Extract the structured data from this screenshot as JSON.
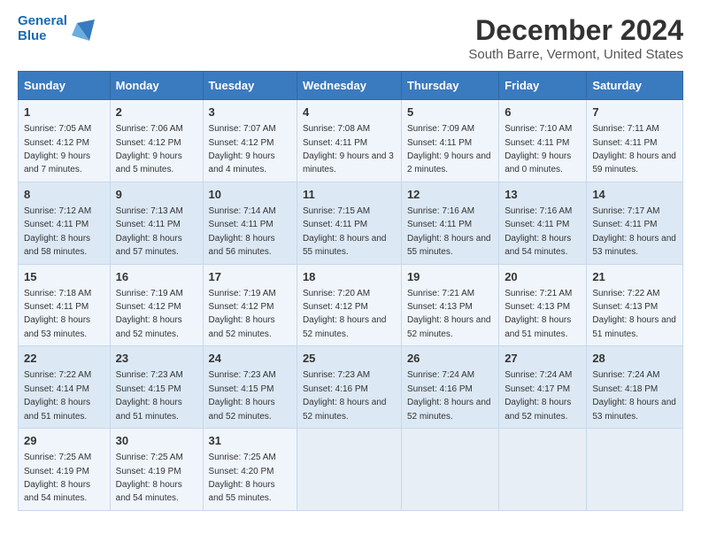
{
  "header": {
    "logo_line1": "General",
    "logo_line2": "Blue",
    "title": "December 2024",
    "subtitle": "South Barre, Vermont, United States"
  },
  "days_of_week": [
    "Sunday",
    "Monday",
    "Tuesday",
    "Wednesday",
    "Thursday",
    "Friday",
    "Saturday"
  ],
  "weeks": [
    [
      {
        "day": "1",
        "sunrise": "7:05 AM",
        "sunset": "4:12 PM",
        "daylight": "9 hours and 7 minutes."
      },
      {
        "day": "2",
        "sunrise": "7:06 AM",
        "sunset": "4:12 PM",
        "daylight": "9 hours and 5 minutes."
      },
      {
        "day": "3",
        "sunrise": "7:07 AM",
        "sunset": "4:12 PM",
        "daylight": "9 hours and 4 minutes."
      },
      {
        "day": "4",
        "sunrise": "7:08 AM",
        "sunset": "4:11 PM",
        "daylight": "9 hours and 3 minutes."
      },
      {
        "day": "5",
        "sunrise": "7:09 AM",
        "sunset": "4:11 PM",
        "daylight": "9 hours and 2 minutes."
      },
      {
        "day": "6",
        "sunrise": "7:10 AM",
        "sunset": "4:11 PM",
        "daylight": "9 hours and 0 minutes."
      },
      {
        "day": "7",
        "sunrise": "7:11 AM",
        "sunset": "4:11 PM",
        "daylight": "8 hours and 59 minutes."
      }
    ],
    [
      {
        "day": "8",
        "sunrise": "7:12 AM",
        "sunset": "4:11 PM",
        "daylight": "8 hours and 58 minutes."
      },
      {
        "day": "9",
        "sunrise": "7:13 AM",
        "sunset": "4:11 PM",
        "daylight": "8 hours and 57 minutes."
      },
      {
        "day": "10",
        "sunrise": "7:14 AM",
        "sunset": "4:11 PM",
        "daylight": "8 hours and 56 minutes."
      },
      {
        "day": "11",
        "sunrise": "7:15 AM",
        "sunset": "4:11 PM",
        "daylight": "8 hours and 55 minutes."
      },
      {
        "day": "12",
        "sunrise": "7:16 AM",
        "sunset": "4:11 PM",
        "daylight": "8 hours and 55 minutes."
      },
      {
        "day": "13",
        "sunrise": "7:16 AM",
        "sunset": "4:11 PM",
        "daylight": "8 hours and 54 minutes."
      },
      {
        "day": "14",
        "sunrise": "7:17 AM",
        "sunset": "4:11 PM",
        "daylight": "8 hours and 53 minutes."
      }
    ],
    [
      {
        "day": "15",
        "sunrise": "7:18 AM",
        "sunset": "4:11 PM",
        "daylight": "8 hours and 53 minutes."
      },
      {
        "day": "16",
        "sunrise": "7:19 AM",
        "sunset": "4:12 PM",
        "daylight": "8 hours and 52 minutes."
      },
      {
        "day": "17",
        "sunrise": "7:19 AM",
        "sunset": "4:12 PM",
        "daylight": "8 hours and 52 minutes."
      },
      {
        "day": "18",
        "sunrise": "7:20 AM",
        "sunset": "4:12 PM",
        "daylight": "8 hours and 52 minutes."
      },
      {
        "day": "19",
        "sunrise": "7:21 AM",
        "sunset": "4:13 PM",
        "daylight": "8 hours and 52 minutes."
      },
      {
        "day": "20",
        "sunrise": "7:21 AM",
        "sunset": "4:13 PM",
        "daylight": "8 hours and 51 minutes."
      },
      {
        "day": "21",
        "sunrise": "7:22 AM",
        "sunset": "4:13 PM",
        "daylight": "8 hours and 51 minutes."
      }
    ],
    [
      {
        "day": "22",
        "sunrise": "7:22 AM",
        "sunset": "4:14 PM",
        "daylight": "8 hours and 51 minutes."
      },
      {
        "day": "23",
        "sunrise": "7:23 AM",
        "sunset": "4:15 PM",
        "daylight": "8 hours and 51 minutes."
      },
      {
        "day": "24",
        "sunrise": "7:23 AM",
        "sunset": "4:15 PM",
        "daylight": "8 hours and 52 minutes."
      },
      {
        "day": "25",
        "sunrise": "7:23 AM",
        "sunset": "4:16 PM",
        "daylight": "8 hours and 52 minutes."
      },
      {
        "day": "26",
        "sunrise": "7:24 AM",
        "sunset": "4:16 PM",
        "daylight": "8 hours and 52 minutes."
      },
      {
        "day": "27",
        "sunrise": "7:24 AM",
        "sunset": "4:17 PM",
        "daylight": "8 hours and 52 minutes."
      },
      {
        "day": "28",
        "sunrise": "7:24 AM",
        "sunset": "4:18 PM",
        "daylight": "8 hours and 53 minutes."
      }
    ],
    [
      {
        "day": "29",
        "sunrise": "7:25 AM",
        "sunset": "4:19 PM",
        "daylight": "8 hours and 54 minutes."
      },
      {
        "day": "30",
        "sunrise": "7:25 AM",
        "sunset": "4:19 PM",
        "daylight": "8 hours and 54 minutes."
      },
      {
        "day": "31",
        "sunrise": "7:25 AM",
        "sunset": "4:20 PM",
        "daylight": "8 hours and 55 minutes."
      },
      null,
      null,
      null,
      null
    ]
  ],
  "labels": {
    "sunrise": "Sunrise:",
    "sunset": "Sunset:",
    "daylight": "Daylight:"
  }
}
